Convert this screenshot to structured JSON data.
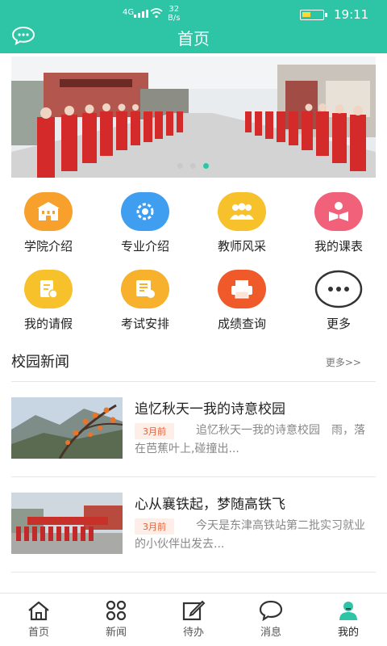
{
  "status": {
    "network": "4G",
    "speed": "32",
    "speed_unit": "B/s",
    "time": "19:11"
  },
  "header": {
    "title": "首页"
  },
  "banner": {
    "slide_count": 3,
    "active_slide": 3
  },
  "menu": {
    "items": [
      {
        "label": "学院介绍",
        "icon": "building-icon",
        "color": "#f7a12c"
      },
      {
        "label": "专业介绍",
        "icon": "flower-icon",
        "color": "#3f9ef0"
      },
      {
        "label": "教师风采",
        "icon": "people-icon",
        "color": "#f7c12c"
      },
      {
        "label": "我的课表",
        "icon": "reader-icon",
        "color": "#f2617a"
      },
      {
        "label": "我的请假",
        "icon": "leave-document-icon",
        "color": "#f7c12c"
      },
      {
        "label": "考试安排",
        "icon": "exam-schedule-icon",
        "color": "#f7b12c"
      },
      {
        "label": "成绩查询",
        "icon": "score-printer-icon",
        "color": "#f05a2a"
      },
      {
        "label": "更多",
        "icon": "more-icon",
        "color": "#333333"
      }
    ]
  },
  "campus_news": {
    "title": "校园新闻",
    "more": "更多>>",
    "items": [
      {
        "title": "追忆秋天一我的诗意校园",
        "date": "3月前",
        "summary": "追忆秋天一我的诗意校园　雨，落在芭蕉叶上,碰撞出..."
      },
      {
        "title": "心从襄铁起，梦随高铁飞",
        "date": "3月前",
        "summary": "今天是东津高铁站第二批实习就业的小伙伴出发去..."
      }
    ]
  },
  "tabbar": {
    "tabs": [
      {
        "label": "首页",
        "icon": "home-icon"
      },
      {
        "label": "新闻",
        "icon": "news-grid-icon"
      },
      {
        "label": "待办",
        "icon": "edit-icon"
      },
      {
        "label": "消息",
        "icon": "message-icon"
      },
      {
        "label": "我的",
        "icon": "user-icon"
      }
    ],
    "active": "我的"
  },
  "colors": {
    "brand": "#2ec4a6",
    "badge_bg": "#fdeee8",
    "badge_text": "#e0623a"
  }
}
